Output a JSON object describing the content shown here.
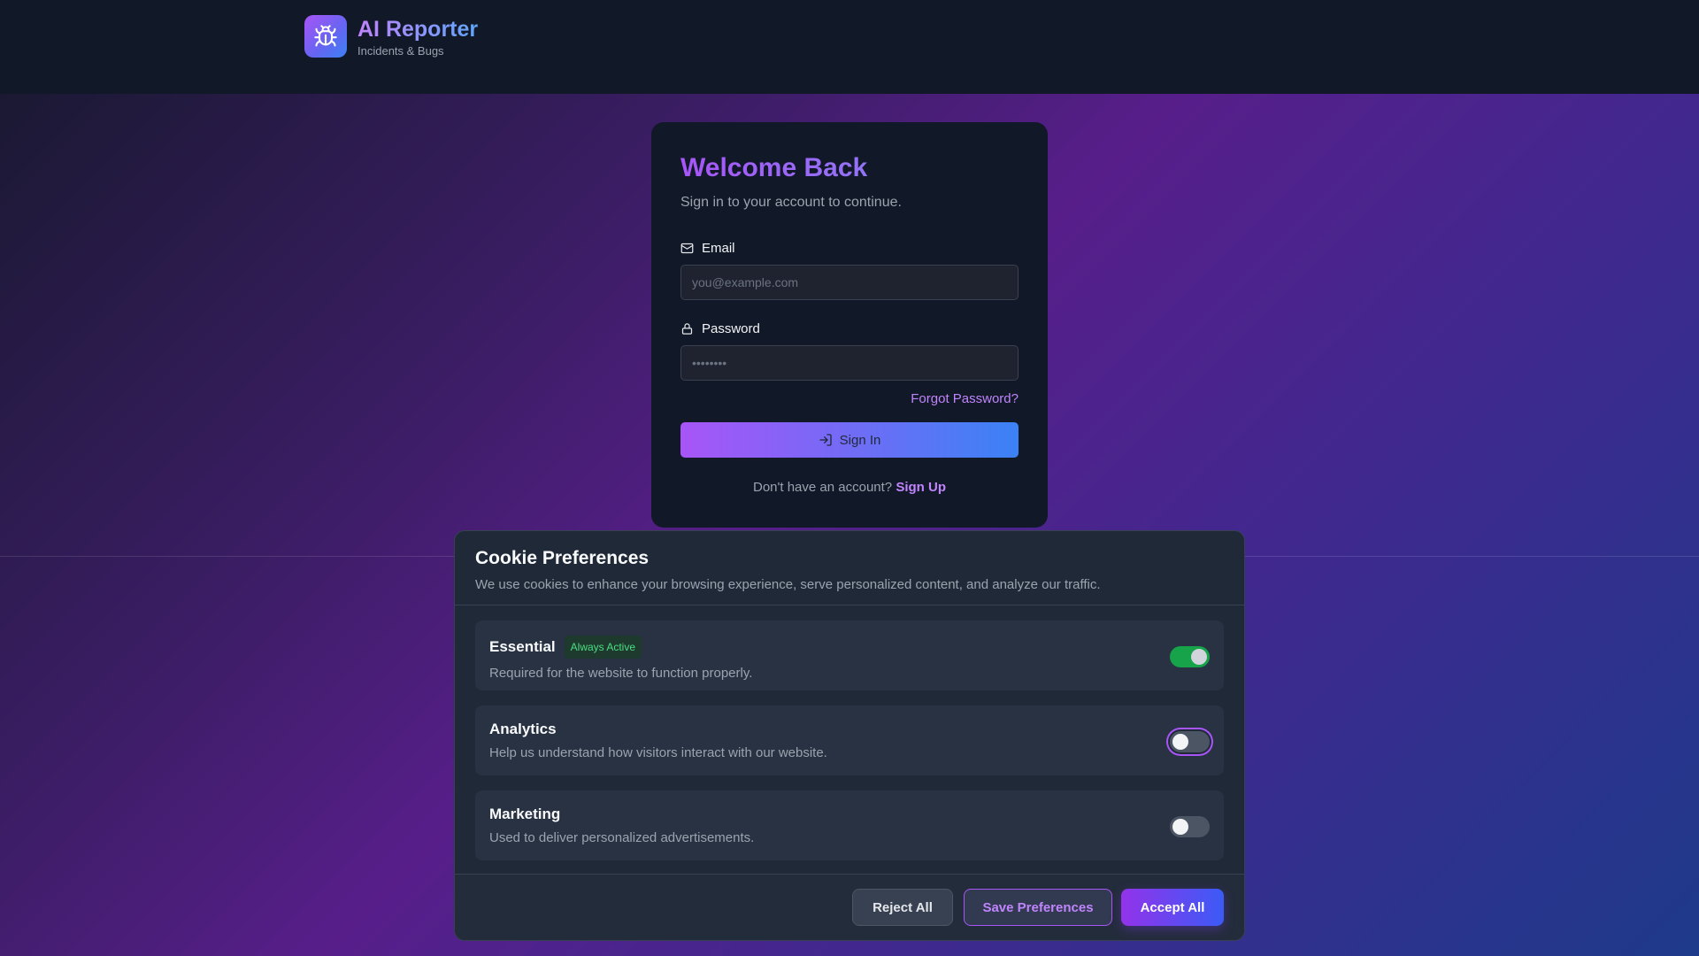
{
  "header": {
    "app_title": "AI Reporter",
    "app_subtitle": "Incidents & Bugs",
    "logo_icon": "bug-icon"
  },
  "login": {
    "title": "Welcome Back",
    "subtitle": "Sign in to your account to continue.",
    "email_label": "Email",
    "email_placeholder": "you@example.com",
    "email_value": "",
    "password_label": "Password",
    "password_placeholder": "••••••••",
    "password_value": "",
    "forgot_password": "Forgot Password?",
    "signin_label": "Sign In",
    "no_account_text": "Don't have an account?",
    "signup_link": "Sign Up"
  },
  "cookie": {
    "title": "Cookie Preferences",
    "description": "We use cookies to enhance your browsing experience, serve personalized content, and analyze our traffic.",
    "preferences": [
      {
        "name": "Essential",
        "badge": "Always Active",
        "description": "Required for the website to function properly.",
        "enabled": true
      },
      {
        "name": "Analytics",
        "badge": "",
        "description": "Help us understand how visitors interact with our website.",
        "enabled": false
      },
      {
        "name": "Marketing",
        "badge": "",
        "description": "Used to deliver personalized advertisements.",
        "enabled": false
      }
    ],
    "reject_label": "Reject All",
    "save_label": "Save Preferences",
    "accept_label": "Accept All"
  },
  "colors": {
    "accent_purple": "#a855f7",
    "accent_blue": "#3b82f6",
    "toggle_on": "#16a34a",
    "badge_green": "#4ade80"
  }
}
